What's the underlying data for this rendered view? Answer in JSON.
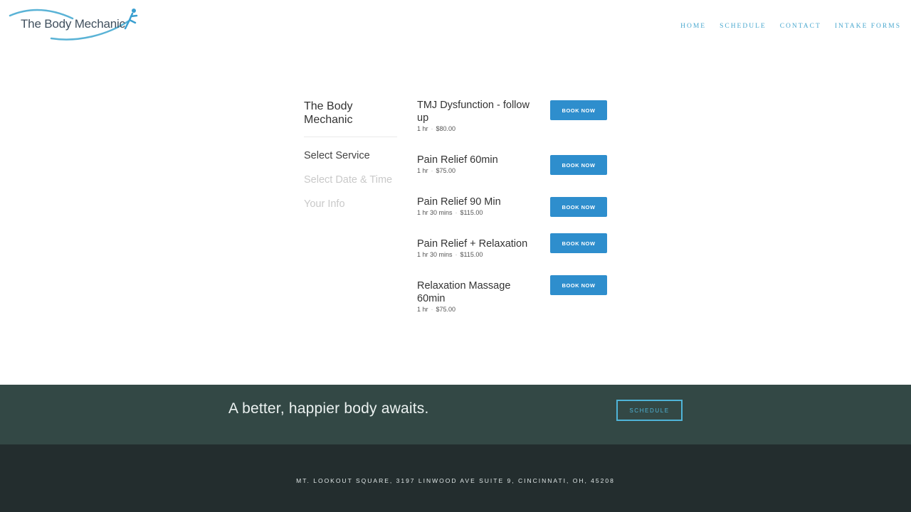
{
  "brand": {
    "name": "The Body Mechanic",
    "accent": "#4aa8cf",
    "button_blue": "#2e8ecd"
  },
  "nav": {
    "items": [
      {
        "label": "HOME"
      },
      {
        "label": "SCHEDULE"
      },
      {
        "label": "CONTACT"
      },
      {
        "label": "INTAKE FORMS"
      }
    ]
  },
  "scheduler": {
    "business": "The Body Mechanic",
    "steps": [
      {
        "label": "Select Service",
        "active": true
      },
      {
        "label": "Select Date & Time",
        "active": false
      },
      {
        "label": "Your Info",
        "active": false
      }
    ],
    "book_label": "BOOK NOW",
    "services": [
      {
        "name": "TMJ Dysfunction - follow up",
        "duration": "1 hr",
        "price": "$80.00"
      },
      {
        "name": "Pain Relief 60min",
        "duration": "1 hr",
        "price": "$75.00"
      },
      {
        "name": "Pain Relief 90 Min",
        "duration": "1 hr 30 mins",
        "price": "$115.00"
      },
      {
        "name": "Pain Relief + Relaxation",
        "duration": "1 hr 30 mins",
        "price": "$115.00"
      },
      {
        "name": "Relaxation Massage 60min",
        "duration": "1 hr",
        "price": "$75.00"
      }
    ]
  },
  "cta": {
    "text": "A better, happier body awaits.",
    "button": "SCHEDULE"
  },
  "footer": {
    "address": "MT. LOOKOUT SQUARE, 3197 LINWOOD AVE SUITE 9, CINCINNATI, OH, 45208"
  }
}
